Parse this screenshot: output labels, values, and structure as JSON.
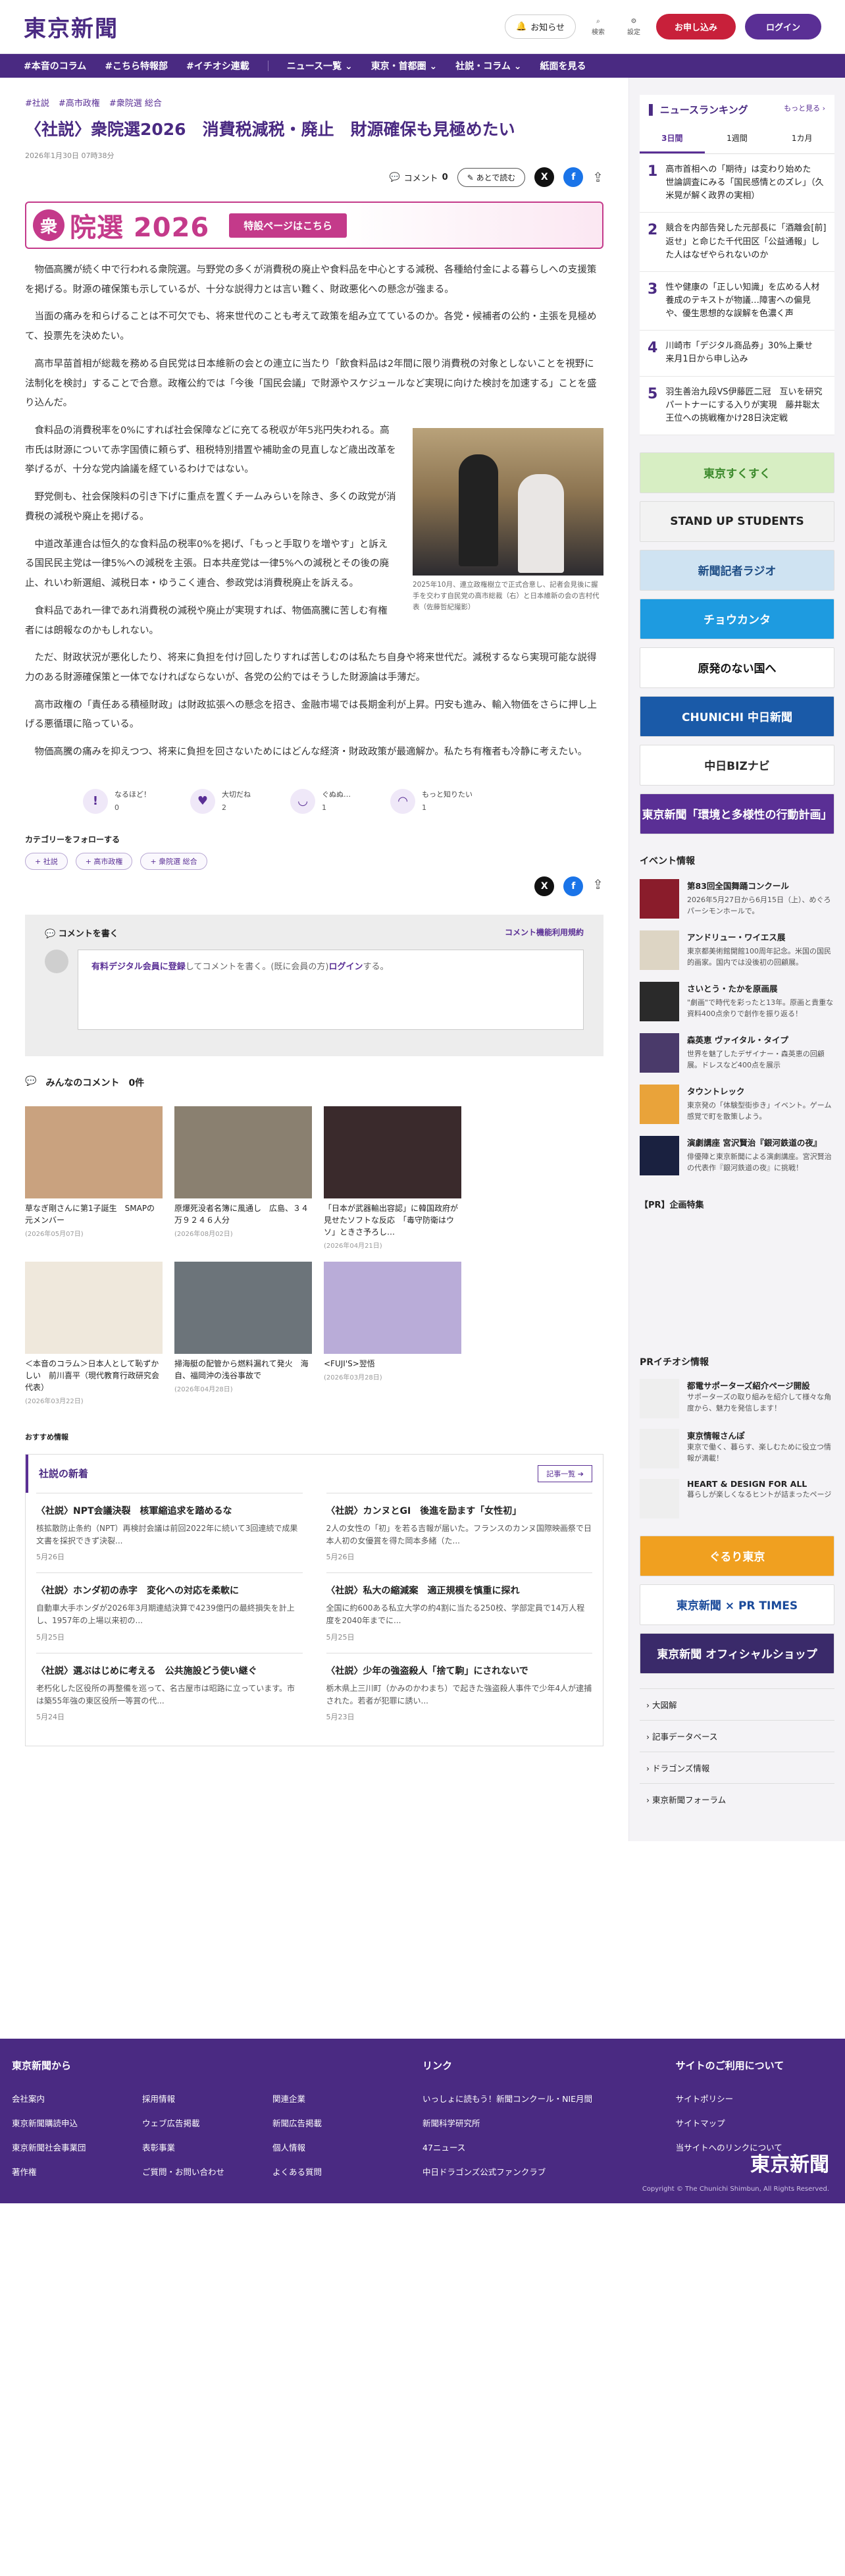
{
  "header": {
    "logo": "東京新聞",
    "notice": "お知らせ",
    "search": "検索",
    "settings": "設定",
    "subscribe": "お申し込み",
    "login": "ログイン"
  },
  "gnav": [
    "#本音のコラム",
    "#こちら特報部",
    "#イチオシ連載",
    "ニュース一覧 ⌄",
    "東京・首都圏 ⌄",
    "社説・コラム ⌄",
    "紙面を見る"
  ],
  "article": {
    "tags": [
      "#社説",
      "#高市政権",
      "#衆院選 総合"
    ],
    "title": "〈社説〉衆院選2026　消費税減税・廃止　財源確保も見極めたい",
    "date": "2026年1月30日 07時38分",
    "comment_label": "コメント",
    "comment_count": "0",
    "later_label": "あとで読む",
    "banner_mark": "衆",
    "banner_title": "院選 2026",
    "banner_button": "特設ページはこちら",
    "photo_caption": "2025年10月、連立政権樹立で正式合意し、記者会見後に握手を交わす自民党の高市総裁（右）と日本維新の会の吉村代表（佐藤哲紀撮影）",
    "paragraphs": [
      "物価高騰が続く中で行われる衆院選。与野党の多くが消費税の廃止や食料品を中心とする減税、各種給付金による暮らしへの支援策を掲げる。財源の確保策も示しているが、十分な説得力とは言い難く、財政悪化への懸念が強まる。",
      "当面の痛みを和らげることは不可欠でも、将来世代のことも考えて政策を組み立てているのか。各党・候補者の公約・主張を見極めて、投票先を決めたい。",
      "高市早苗首相が総裁を務める自民党は日本維新の会との連立に当たり「飲食料品は2年間に限り消費税の対象としないことを視野に法制化を検討」することで合意。政権公約では「今後「国民会議」で財源やスケジュールなど実現に向けた検討を加速する」ことを盛り込んだ。",
      "食料品の消費税率を0%にすれば社会保障などに充てる税収が年5兆円失われる。高市氏は財源について赤字国債に頼らず、租税特別措置や補助金の見直しなど歳出改革を挙げるが、十分な党内論議を経ているわけではない。",
      "野党側も、社会保険料の引き下げに重点を置くチームみらいを除き、多くの政党が消費税の減税や廃止を掲げる。",
      "中道改革連合は恒久的な食料品の税率0%を掲げ、「もっと手取りを増やす」と訴える国民民主党は一律5%への減税を主張。日本共産党は一律5%への減税とその後の廃止、れいわ新選組、減税日本・ゆうこく連合、参政党は消費税廃止を訴える。",
      "食料品であれ一律であれ消費税の減税や廃止が実現すれば、物価高騰に苦しむ有権者には朗報なのかもしれない。",
      "ただ、財政状況が悪化したり、将来に負担を付け回したりすれば苦しむのは私たち自身や将来世代だ。減税するなら実現可能な説得力のある財源確保策と一体でなければならないが、各党の公約ではそうした財源論は手薄だ。",
      "高市政権の「責任ある積極財政」は財政拡張への懸念を招き、金融市場では長期金利が上昇。円安も進み、輸入物価をさらに押し上げる悪循環に陥っている。",
      "物価高騰の痛みを抑えつつ、将来に負担を回さないためにはどんな経済・財政政策が最適解か。私たち有権者も冷静に考えたい。"
    ],
    "reactions": [
      {
        "label": "なるほど！",
        "count": "0",
        "icon": "!"
      },
      {
        "label": "大切だね",
        "count": "2",
        "icon": "♥"
      },
      {
        "label": "ぐぬぬ…",
        "count": "1",
        "icon": "◡"
      },
      {
        "label": "もっと知りたい",
        "count": "1",
        "icon": "◠"
      }
    ],
    "follow_label": "カテゴリーをフォローする",
    "follow_chips": [
      "+ 社説",
      "+ 高市政権",
      "+ 衆院選 総合"
    ]
  },
  "comment_box": {
    "title": "コメントを書く",
    "rules": "コメント機能利用規約",
    "prompt_link": "有料デジタル会員に登録",
    "prompt_mid": "してコメントを書く。(既に会員の方)",
    "prompt_login": "ログイン",
    "prompt_end": "する。",
    "list_title": "みんなのコメント",
    "list_count": "0件"
  },
  "thumbs": [
    {
      "title": "草なぎ剛さんに第1子誕生　SMAPの元メンバー",
      "date": "(2026年05月07日)",
      "color": "#c9a27f"
    },
    {
      "title": "原爆死没者名簿に風通し　広島、３４万９２４６人分",
      "date": "(2026年08月02日)",
      "color": "#8a8070"
    },
    {
      "title": "「日本が武器輸出容認」に韓国政府が見せたソフトな反応　「毒守防衛はウソ」ときさ予ろし…",
      "date": "(2026年04月21日)",
      "color": "#3a2a2c"
    },
    {
      "title": "＜本音のコラム＞日本人として恥ずかしい　前川喜平（現代教育行政研究会代表）",
      "date": "(2026年03月22日)",
      "color": "#efe8dc"
    },
    {
      "title": "掃海艇の配管から燃料漏れて発火　海自、福岡沖の浅谷事故で",
      "date": "(2026年04月28日)",
      "color": "#6c747a"
    },
    {
      "title": "<FUJI'S>翌悟",
      "date": "(2026年03月28日)",
      "color": "#b9acd8"
    }
  ],
  "recommend_label": "おすすめ情報",
  "shashin": {
    "title": "社説の新着",
    "more": "記事一覧 ➔",
    "items": [
      {
        "title": "〈社説〉NPT会議決裂　核軍縮追求を踏めるな",
        "text": "核拡散防止条約（NPT）再検討会議は前回2022年に続いて3回連続で成果文書を採択できず決裂...",
        "date": "5月26日"
      },
      {
        "title": "〈社説〉カンヌとGI　後進を励ます「女性初」",
        "text": "2人の女性の「初」を若る吉報が届いた。フランスのカンヌ国際映画祭で日本人初の女優賞を得た岡本多緒（た...",
        "date": "5月26日"
      },
      {
        "title": "〈社説〉ホンダ初の赤字　変化への対応を柔軟に",
        "text": "自動車大手ホンダが2026年3月期連結決算で4239億円の最終損失を計上し、1957年の上場以来初の...",
        "date": "5月25日"
      },
      {
        "title": "〈社説〉私大の縮減案　適正規模を慎重に探れ",
        "text": "全国に約600ある私立大学の約4割に当たる250校、学部定員で14万人程度を2040年までに...",
        "date": "5月25日"
      },
      {
        "title": "〈社説〉選ぶはじめに考える　公共施設どう使い継ぐ",
        "text": "老朽化した区役所の再整備を巡って、名古屋市は昭路に立っています。市は築55年強の東区役所一等賞の代...",
        "date": "5月24日"
      },
      {
        "title": "〈社説〉少年の強盗殺人「捨て駒」にされないで",
        "text": "栃木県上三川町（かみのかわまち）で起きた強盗殺人事件で少年4人が逮捕された。若者が犯罪に誘い...",
        "date": "5月23日"
      }
    ]
  },
  "ranking": {
    "title": "ニュースランキング",
    "more": "もっと見る ›",
    "tabs": [
      "3日間",
      "1週間",
      "1カ月"
    ],
    "items": [
      {
        "num": "1",
        "text": "高市首相への「期待」は変わり始めた　世論調査にみる「国民感情とのズレ」（久米晃が解く政界の実相）"
      },
      {
        "num": "2",
        "text": "競合を内部告発した元部長に「酒離会[前]返せ」と命じた千代田区「公益通報」した人はなぜやられないのか"
      },
      {
        "num": "3",
        "text": "性や健康の「正しい知識」を広める人材養成のテキストが物議…障害への偏見や、優生思想的な誤解を色濃く声"
      },
      {
        "num": "4",
        "text": "川崎市「デジタル商品券」30%上乗せ　来月1日から申し込み"
      },
      {
        "num": "5",
        "text": "羽生善治九段VS伊藤匠二冠　互いを研究パートナーにする入りが実現　藤井聡太王位への挑戦権かけ28日決定戦"
      }
    ]
  },
  "side_ads": [
    {
      "text": "東京すくすく",
      "bg": "#d7eec3",
      "fg": "#3c8a2c"
    },
    {
      "text": "STAND UP STUDENTS",
      "bg": "#f2f2f2",
      "fg": "#222"
    },
    {
      "text": "新聞記者ラジオ",
      "bg": "#cfe3f2",
      "fg": "#1f4e86"
    },
    {
      "text": "チョウカンタ",
      "bg": "#1e9be0",
      "fg": "#ffffff"
    },
    {
      "text": "原発のない国へ",
      "bg": "#ffffff",
      "fg": "#111"
    },
    {
      "text": "CHUNICHI 中日新聞",
      "bg": "#1a5aa8",
      "fg": "#ffffff"
    },
    {
      "text": "中日BIZナビ",
      "bg": "#ffffff",
      "fg": "#2a2a2a"
    },
    {
      "text": "東京新聞「環境と多様性の行動計画」",
      "bg": "#5a2f95",
      "fg": "#ffffff"
    }
  ],
  "events": {
    "title": "イベント情報",
    "items": [
      {
        "title": "第83回全国舞踊コンクール",
        "text": "2026年5月27日から6月15日（上）、めぐろパーシモンホールで。",
        "color": "#8a1c2b"
      },
      {
        "title": "アンドリュー・ワイエス展",
        "text": "東京都美術館開館100周年記念。米国の国民的画家。国内では没後初の回顧展。",
        "color": "#ddd5c4"
      },
      {
        "title": "さいとう・たかを原画展",
        "text": "\"劇画\"で時代を彩ったと13年。原画と貴重な資料400点余りで創作を振り返る！",
        "color": "#2a2a2a"
      },
      {
        "title": "森英恵 ヴァイタル・タイプ",
        "text": "世界を魅了したデザイナー・森英恵の回顧展。ドレスなど400点を展示",
        "color": "#4a3a6a"
      },
      {
        "title": "タウントレック",
        "text": "東京発の「体験型街歩き」イベント。ゲーム感覚で町を散策しよう。",
        "color": "#e9a33a"
      },
      {
        "title": "演劇講座 宮沢賢治『銀河鉄道の夜』",
        "text": "俳優陣と東京新聞による演劇講座。宮沢賢治の代表作『銀河鉄道の夜』に挑戦！",
        "color": "#1a2140"
      }
    ]
  },
  "pr_feature": "【PR】企画特集",
  "pr_info": {
    "title": "PRイチオシ情報",
    "items": [
      {
        "title": "都電サポーターズ紹介ページ開設",
        "text": "サポーターズの取り組みを紹介して様々な角度から、魅力を発信します！"
      },
      {
        "title": "東京情報さんぽ",
        "text": "東京で働く、暮らす、楽しむために役立つ情報が満載！"
      },
      {
        "title": "HEART & DESIGN FOR ALL",
        "text": "暮らしが楽しくなるヒントが詰まったページ"
      }
    ]
  },
  "side_banners": [
    {
      "text": "ぐるり東京",
      "bg": "#f0a020",
      "fg": "#ffffff"
    },
    {
      "text": "東京新聞 × PR TIMES",
      "bg": "#ffffff",
      "fg": "#1a4a9a"
    },
    {
      "text": "東京新聞 オフィシャルショップ",
      "bg": "#3a2a6a",
      "fg": "#ffffff"
    }
  ],
  "side_links": [
    "›  大図解",
    "›  記事データベース",
    "›  ドラゴンズ情報",
    "›  東京新聞フォーラム"
  ],
  "footer": {
    "col1_title": "東京新聞から",
    "col1_links": [
      "会社案内",
      "採用情報",
      "関連企業",
      "東京新聞購読申込",
      "ウェブ広告掲載",
      "新聞広告掲載",
      "東京新聞社会事業団",
      "表彰事業",
      "個人情報",
      "著作権",
      "ご質問・お問い合わせ",
      "よくある質問"
    ],
    "col2_title": "リンク",
    "col2_links": [
      "いっしょに読もう！新聞コンクール・NIE月間",
      "新聞科学研究所",
      "47ニュース",
      "中日ドラゴンズ公式ファンクラブ"
    ],
    "col3_title": "サイトのご利用について",
    "col3_links": [
      "サイトポリシー",
      "サイトマップ",
      "当サイトへのリンクについて"
    ],
    "logo": "東京新聞",
    "copyright": "Copyright © The Chunichi Shimbun, All Rights Reserved."
  }
}
